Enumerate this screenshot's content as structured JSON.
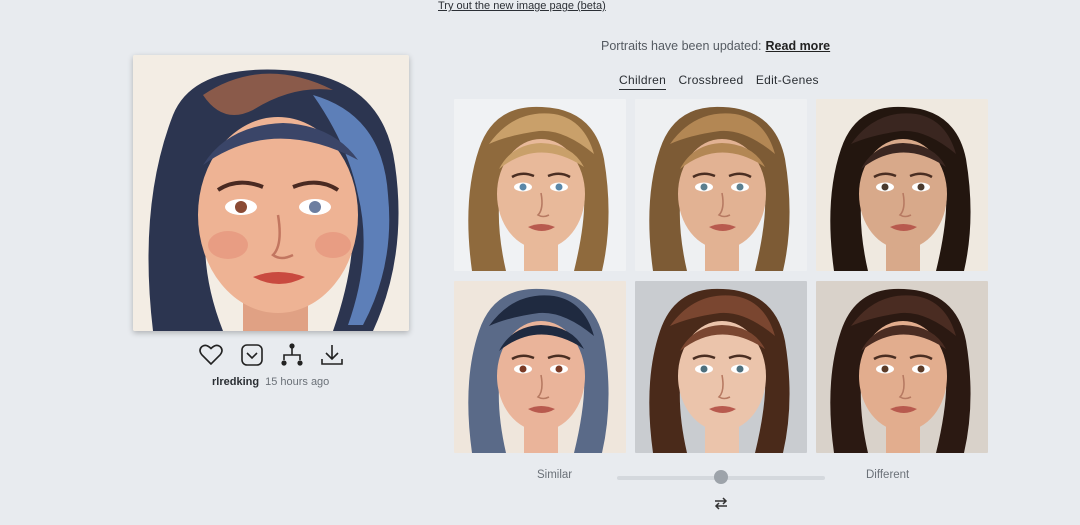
{
  "top_link": "Try out the new image page (beta)",
  "main_image": {
    "alt": "Painted portrait of a woman with dark and blue hair"
  },
  "actions": [
    {
      "name": "like",
      "icon": "heart-icon"
    },
    {
      "name": "save",
      "icon": "bookmark-icon"
    },
    {
      "name": "family-tree",
      "icon": "tree-icon"
    },
    {
      "name": "download",
      "icon": "download-icon"
    }
  ],
  "meta": {
    "username": "rlredking",
    "time": "15 hours ago"
  },
  "notice": {
    "text": "Portraits have been updated:",
    "link": "Read more"
  },
  "tabs": [
    {
      "label": "Children",
      "active": true
    },
    {
      "label": "Crossbreed",
      "active": false
    },
    {
      "label": "Edit-Genes",
      "active": false
    }
  ],
  "grid": [
    {
      "hair": "#c9a06a",
      "hair2": "#8f6a3d",
      "skin": "#e8b99a",
      "bg": "#f0f2f4",
      "eyes": "#5a87a8"
    },
    {
      "hair": "#b38754",
      "hair2": "#7d5b35",
      "skin": "#e2b293",
      "bg": "#eef0f2",
      "eyes": "#5b7f8f"
    },
    {
      "hair": "#3a2620",
      "hair2": "#23160f",
      "skin": "#d8a98a",
      "bg": "#efe9e0",
      "eyes": "#4a3a2e"
    },
    {
      "hair": "#1f2a40",
      "hair2": "#5a6a88",
      "skin": "#eab49a",
      "bg": "#efe6dc",
      "eyes": "#7a3a25"
    },
    {
      "hair": "#7a4630",
      "hair2": "#4a2a1a",
      "skin": "#ebc4ab",
      "bg": "#c9ccd0",
      "eyes": "#4d6f7d"
    },
    {
      "hair": "#4a2c22",
      "hair2": "#2b1912",
      "skin": "#e2ad8e",
      "bg": "#d9d2ca",
      "eyes": "#5b3b28"
    }
  ],
  "slider": {
    "left_label": "Similar",
    "right_label": "Different",
    "value": 0.5
  },
  "colors": {
    "accent": "#2a2e33",
    "background": "#e8ebef"
  }
}
